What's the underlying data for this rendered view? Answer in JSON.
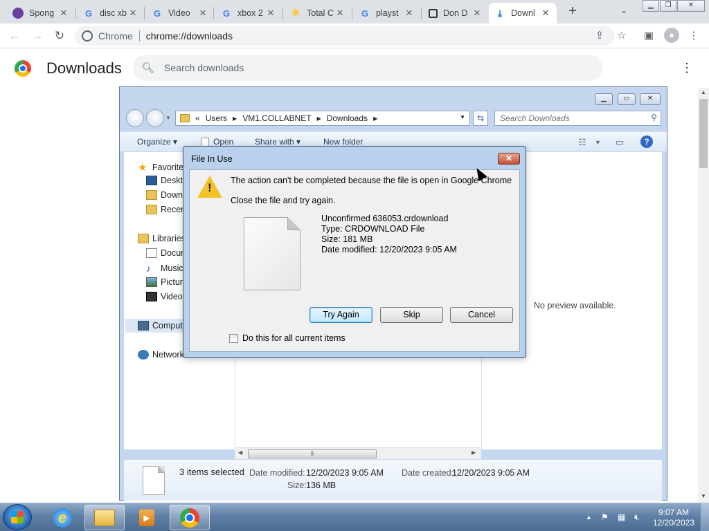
{
  "browser": {
    "tabs": [
      {
        "label": "Spong",
        "icon": "spongebob-icon"
      },
      {
        "label": "disc xb",
        "icon": "google-icon"
      },
      {
        "label": "Video",
        "icon": "google-icon"
      },
      {
        "label": "xbox 2",
        "icon": "google-icon"
      },
      {
        "label": "Total C",
        "icon": "walmart-icon"
      },
      {
        "label": "playst",
        "icon": "google-icon"
      },
      {
        "label": "Don D",
        "icon": "page-icon"
      },
      {
        "label": "Downl",
        "icon": "download-icon"
      }
    ],
    "omnibox": {
      "chip": "Chrome",
      "url": "chrome://downloads"
    }
  },
  "downloads_page": {
    "title": "Downloads",
    "search_placeholder": "Search downloads"
  },
  "explorer": {
    "breadcrumb": [
      "«",
      "Users",
      "VM1.COLLABNET",
      "Downloads"
    ],
    "search_placeholder": "Search Downloads",
    "commands": [
      "Organize",
      "Open",
      "Share with",
      "New folder"
    ],
    "nav": [
      {
        "label": "Favorites",
        "icon": "star-icon",
        "level": 0
      },
      {
        "label": "Desktop",
        "icon": "desktop-icon",
        "level": 1
      },
      {
        "label": "Downloads",
        "icon": "downloads-folder-icon",
        "level": 1
      },
      {
        "label": "Recent Places",
        "icon": "recent-icon",
        "level": 1
      },
      {
        "label": "Libraries",
        "icon": "libraries-icon",
        "level": 0
      },
      {
        "label": "Documents",
        "icon": "documents-icon",
        "level": 1
      },
      {
        "label": "Music",
        "icon": "music-icon",
        "level": 1
      },
      {
        "label": "Pictures",
        "icon": "pictures-icon",
        "level": 1
      },
      {
        "label": "Videos",
        "icon": "videos-icon",
        "level": 1
      },
      {
        "label": "Computer",
        "icon": "computer-icon",
        "level": 0
      },
      {
        "label": "Network",
        "icon": "network-icon",
        "level": 0
      }
    ],
    "preview_text": "No preview available.",
    "details": {
      "selection": "3 items selected",
      "modified_label": "Date modified:",
      "modified_value": "12/20/2023 9:05 AM",
      "created_label": "Date created:",
      "created_value": "12/20/2023 9:05 AM",
      "size_label": "Size:",
      "size_value": "136 MB"
    }
  },
  "dialog": {
    "title": "File In Use",
    "message": "The action can't be completed because the file is open in Google Chrome",
    "instruction": "Close the file and try again.",
    "file": {
      "name": "Unconfirmed 636053.crdownload",
      "type": "Type: CRDOWNLOAD File",
      "size": "Size: 181 MB",
      "modified": "Date modified: 12/20/2023 9:05 AM"
    },
    "buttons": {
      "try_again": "Try Again",
      "skip": "Skip",
      "cancel": "Cancel"
    },
    "checkbox_label": "Do this for all current items"
  },
  "taskbar": {
    "time": "9:07 AM",
    "date": "12/20/2023"
  }
}
